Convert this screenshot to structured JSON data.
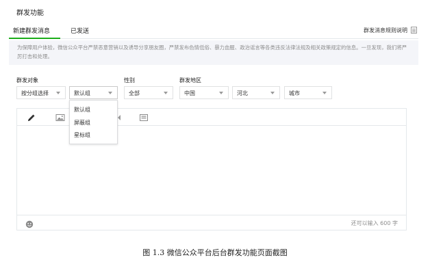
{
  "page": {
    "title": "群发功能"
  },
  "tabs": [
    {
      "label": "新建群发消息",
      "active": true
    },
    {
      "label": "已发送",
      "active": false
    }
  ],
  "rule_link": "群发消息规则说明",
  "notice": "为保障用户体验，微信公众平台严禁恶意营销以及诱导分享朋友圈，严禁发布色情低俗、暴力血腥、政治谣言等各类违反法律法规及相关政策规定的信息。一旦发现，我们将严厉打击和处理。",
  "filters": {
    "target_label": "群发对象",
    "gender_label": "性别",
    "region_label": "群发地区",
    "group_select": "按分组选择",
    "group_value": "默认组",
    "gender_value": "全部",
    "country_value": "中国",
    "province_value": "河北",
    "city_value": "城市"
  },
  "group_dropdown": {
    "options": [
      "默认组",
      "屏蔽组",
      "星标组"
    ]
  },
  "editor": {
    "counter": "还可以输入 600 字"
  },
  "caption": "图 1.3  微信公众平台后台群发功能页面截图",
  "colors": {
    "accent": "#1aad19",
    "notice_bg": "#f4f5f9",
    "border": "#e4e8eb"
  },
  "icons": [
    "pencil-icon",
    "image-icon",
    "audio-icon",
    "video-icon",
    "smiley-icon",
    "doc-icon"
  ]
}
